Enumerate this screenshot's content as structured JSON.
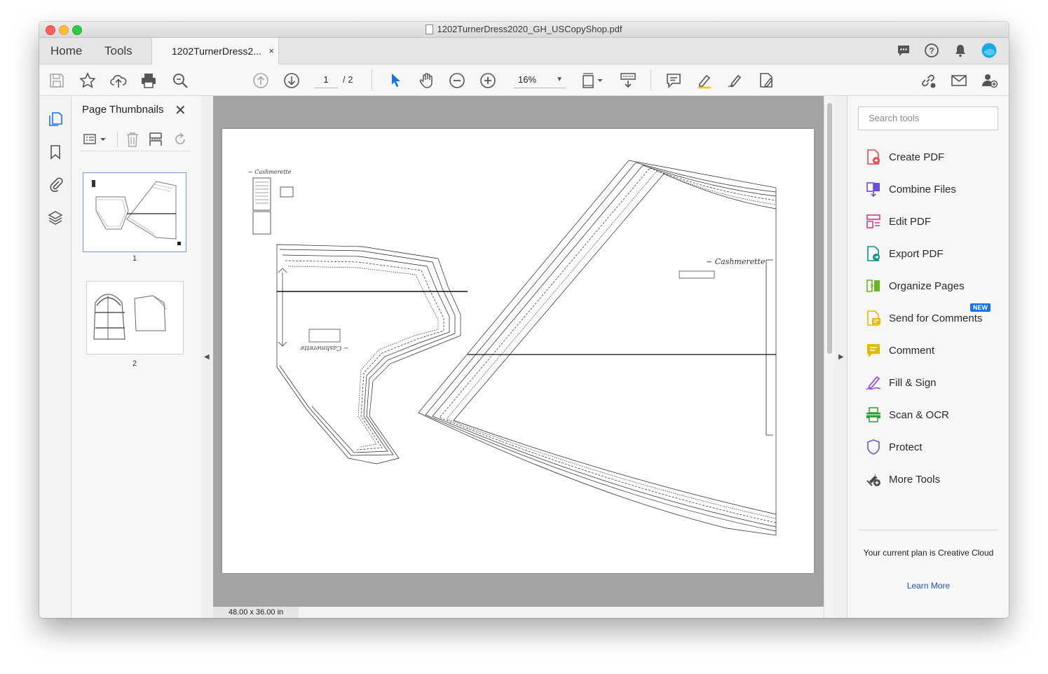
{
  "window": {
    "title": "1202TurnerDress2020_GH_USCopyShop.pdf"
  },
  "tabs": {
    "home": "Home",
    "tools": "Tools",
    "document": "1202TurnerDress2...",
    "close": "×"
  },
  "toolbar": {
    "current_page": "1",
    "total_pages": "/ 2",
    "zoom": "16%"
  },
  "thumbnails_panel": {
    "title": "Page Thumbnails",
    "close": "✕",
    "pages": [
      {
        "number": "1"
      },
      {
        "number": "2"
      }
    ]
  },
  "document": {
    "size": "48.00 x 36.00 in"
  },
  "tools_pane": {
    "search_placeholder": "Search tools",
    "items": [
      {
        "label": "Create PDF",
        "icon": "create-pdf-icon",
        "color": "#e34850"
      },
      {
        "label": "Combine Files",
        "icon": "combine-files-icon",
        "color": "#6a4fd6"
      },
      {
        "label": "Edit PDF",
        "icon": "edit-pdf-icon",
        "color": "#d83790"
      },
      {
        "label": "Export PDF",
        "icon": "export-pdf-icon",
        "color": "#0d8f8f"
      },
      {
        "label": "Organize Pages",
        "icon": "organize-pages-icon",
        "color": "#6bb528"
      },
      {
        "label": "Send for Comments",
        "icon": "send-comments-icon",
        "color": "#e7b800"
      },
      {
        "label": "Comment",
        "icon": "comment-icon",
        "color": "#e7b800"
      },
      {
        "label": "Fill & Sign",
        "icon": "fill-sign-icon",
        "color": "#8f49d6"
      },
      {
        "label": "Scan & OCR",
        "icon": "scan-ocr-icon",
        "color": "#2d9d3a"
      },
      {
        "label": "Protect",
        "icon": "protect-icon",
        "color": "#6a62e0"
      },
      {
        "label": "More Tools",
        "icon": "more-tools-icon",
        "color": "#4b4b4b"
      }
    ],
    "new_badge": "NEW",
    "plan_text": "Your current plan is Creative Cloud",
    "learn_more": "Learn More"
  }
}
